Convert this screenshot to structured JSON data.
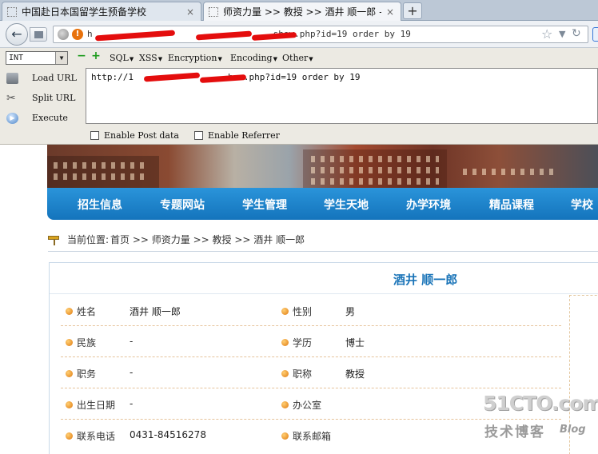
{
  "browser": {
    "tabs": [
      {
        "title": "中国赴日本国留学生预备学校",
        "close": "×"
      },
      {
        "title": "师资力量 >> 教授 >> 酒井 顺一郎 -",
        "close": "×"
      }
    ],
    "new_tab": "+",
    "url_visible_suffix": "show.php?id=19 order by 19",
    "url_prefix_visible": "h"
  },
  "hackbar": {
    "select_value": "INT",
    "menus": [
      "SQL",
      "XSS",
      "Encoding",
      "Encryption",
      "Other"
    ],
    "menu_order": [
      "SQL",
      "XSS",
      "Encryption",
      "Encoding",
      "Other"
    ],
    "actions": {
      "load": "Load URL",
      "split": "Split URL",
      "execute": "Execute"
    },
    "textarea_prefix": "http://1",
    "textarea_suffix": "how.php?id=19 order by 19",
    "checkboxes": {
      "post": "Enable Post data",
      "referrer": "Enable Referrer"
    }
  },
  "site": {
    "nav": [
      "招生信息",
      "专题网站",
      "学生管理",
      "学生天地",
      "办学环境",
      "精品课程",
      "学校"
    ],
    "breadcrumb": {
      "label": "当前位置:",
      "path": "首页 >> 师资力量 >> 教授 >> 酒井 顺一郎"
    },
    "profile": {
      "name_heading": "酒井 顺一郎",
      "rows": [
        {
          "l_label": "姓名",
          "l_value": "酒井 顺一郎",
          "r_label": "性别",
          "r_value": "男"
        },
        {
          "l_label": "民族",
          "l_value": "-",
          "r_label": "学历",
          "r_value": "博士"
        },
        {
          "l_label": "职务",
          "l_value": "-",
          "r_label": "职称",
          "r_value": "教授"
        },
        {
          "l_label": "出生日期",
          "l_value": "-",
          "r_label": "办公室",
          "r_value": ""
        },
        {
          "l_label": "联系电话",
          "l_value": "0431-84516278",
          "r_label": "联系邮箱",
          "r_value": ""
        }
      ]
    }
  },
  "watermark": {
    "main": "51CTO.com",
    "sub": "技术博客",
    "blog": "Blog"
  },
  "colors": {
    "nav_blue": "#1a7fc9",
    "accent_title": "#1a74b8",
    "warning": "#e8720c"
  }
}
